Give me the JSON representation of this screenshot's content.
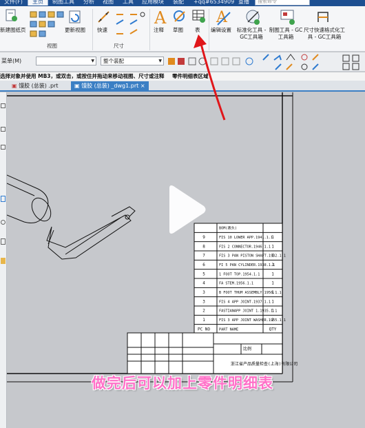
{
  "tabs": [
    "文件(F)",
    "主页",
    "制图工具",
    "分析",
    "视图",
    "工具",
    "应用模块",
    "装配",
    "+qq#6534909",
    "重播"
  ],
  "search_placeholder": "搜索命令",
  "ribbon": {
    "items": {
      "new_sheet": "新建图纸页",
      "view_group": "视图",
      "update_view": "更新视图",
      "quick": "快速",
      "dimension_group": "尺寸",
      "note": "注释",
      "sketch": "草图",
      "table": "表",
      "edit_settings": "编辑设置",
      "gc_std": "标准化工具 - GC工具箱",
      "gc_draw": "制图工具 - GC工具箱",
      "gc_dim": "尺寸快速格式化工具 - GC工具箱"
    }
  },
  "toolbar2": {
    "menu": "菜单(M)",
    "filter_value": "",
    "assembly_scope": "整个装配"
  },
  "status_text": "选择对象并使用 MB3，或双击，或按住并拖动来移动视图、尺寸或注释",
  "status_right": "零件明细表区域",
  "doc_tabs": [
    "馒胶 (总装) .prt",
    "馒胶 (总装) _dwg1.prt"
  ],
  "parts_list": {
    "rows": [
      {
        "no": "",
        "name": "BOM(表头)",
        "qty": ""
      },
      {
        "no": "9",
        "name": "FIS 10 LOWER APP.1941.1.1",
        "qty": "1"
      },
      {
        "no": "8",
        "name": "FIS 2 CONNECTOR.1946.1.1",
        "qty": "1"
      },
      {
        "no": "7",
        "name": "FIS 3 PAN PISTON SHAFT.1932.1.1",
        "qty": "1"
      },
      {
        "no": "6",
        "name": "FI 5 PAN CYLINDER.1938.1.1",
        "qty": "1"
      },
      {
        "no": "5",
        "name": "1 FOOT TOP.1954.1.1",
        "qty": "1"
      },
      {
        "no": "4",
        "name": "FA STEM.1956.1.1",
        "qty": "1"
      },
      {
        "no": "3",
        "name": "B FOOT THUM ASSEMBLY.1950.1.1",
        "qty": "1"
      },
      {
        "no": "3",
        "name": "FIS 4 APP JOINT.1937.1.1",
        "qty": "1"
      },
      {
        "no": "2",
        "name": "FASTIANAPP JOINT 1.1935.1.1",
        "qty": "1"
      },
      {
        "no": "1",
        "name": "FIS 3 APP JOINT WASHER.1955.1.1",
        "qty": "2"
      }
    ],
    "footer": {
      "no": "PC NO",
      "name": "PART NAME",
      "qty": "QTY"
    }
  },
  "title_block": {
    "company": "浙江省产品质量检查(上海)有限公司",
    "scale_label": "比例"
  },
  "caption": "做完后可以加上零件明细表",
  "colors": {
    "accent": "#1d4f91",
    "caption": "#ff71c8",
    "arrow": "#e0161a",
    "doc_tab": "#3b7fc4"
  }
}
